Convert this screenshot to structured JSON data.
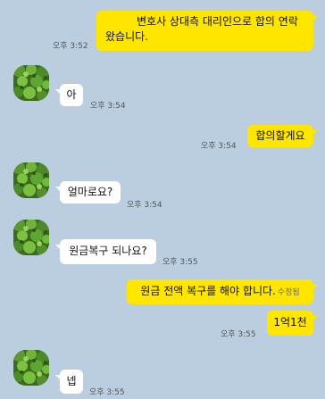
{
  "messages": [
    {
      "side": "me",
      "text": "변호사 상대측 대리인으로 합의 연락왔습니다.",
      "time": "오후 3:52"
    },
    {
      "side": "other",
      "text": "아",
      "time": "오후 3:54"
    },
    {
      "side": "me",
      "text": "합의할게요",
      "time": "오후 3:54"
    },
    {
      "side": "other",
      "text": "얼마로요?",
      "time": "오후 3:54"
    },
    {
      "side": "other",
      "text": "원금복구 되나요?",
      "time": "오후 3:55"
    },
    {
      "side": "me",
      "text": "원금 전액 복구를 해야 합니다.",
      "edited": "수정됨",
      "time": ""
    },
    {
      "side": "me",
      "text": "1억1천",
      "time": "오후 3:55"
    },
    {
      "side": "other",
      "text": "넵",
      "time": "오후 3:55"
    }
  ],
  "colors": {
    "background": "#bacee0",
    "my_bubble": "#ffe600",
    "other_bubble": "#ffffff"
  },
  "icons": {
    "avatar": "green-leaves-avatar-icon"
  }
}
